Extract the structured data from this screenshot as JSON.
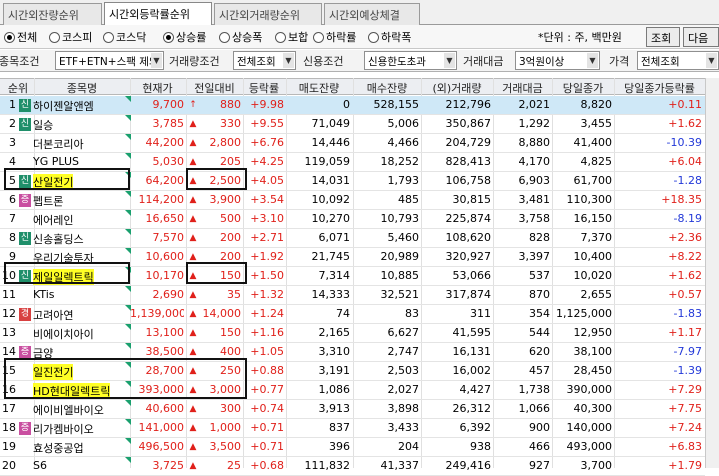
{
  "tabs": [
    "시간외잔량순위",
    "시간외등락률순위",
    "시간외거래량순위",
    "시간외예상체결"
  ],
  "active_tab": 1,
  "market_radios": [
    "전체",
    "코스피",
    "코스닥"
  ],
  "rank_radios": [
    "상승률",
    "상승폭",
    "보합",
    "하락률",
    "하락폭"
  ],
  "unit_text": "*단위 : 주, 백만원",
  "query_button": "조회",
  "next_button": "다음",
  "filters": {
    "item_cond_label": "종목조건",
    "item_cond_value": "ETF+ETN+스팩 제외",
    "trade_cond_label": "거래량조건",
    "trade_cond_value": "전체조회",
    "credit_cond_label": "신용조건",
    "credit_cond_value": "신용한도초과",
    "amount_label": "거래대금",
    "amount_value": "3억원이상",
    "price_label": "가격",
    "price_value": "전체조회"
  },
  "columns": [
    "순위",
    "종목명",
    "현재가",
    "전일대비",
    "등락률",
    "매도잔량",
    "매수잔량",
    "(외)거래량",
    "거래대금",
    "당일종가",
    "당일종가등락률"
  ],
  "colors": {
    "up": "#e0201a",
    "down": "#2238d8",
    "highlight": "#ffff26",
    "badge_sin": "#1f8f6a",
    "badge_jeung": "#c94fa0",
    "badge_gyeong": "#d84040"
  },
  "rows": [
    {
      "rank": "1",
      "badge": "신",
      "name": "하이젠알앤엠",
      "price": "9,700",
      "dir": "limit",
      "change": "880",
      "rate": "+9.98",
      "sell": "0",
      "buy": "528,155",
      "volume": "212,796",
      "amount": "2,021",
      "close": "8,820",
      "close_rate": "+0.11",
      "close_up": true
    },
    {
      "rank": "2",
      "badge": "신",
      "name": "일승",
      "price": "3,785",
      "dir": "up",
      "change": "330",
      "rate": "+9.55",
      "sell": "71,049",
      "buy": "5,006",
      "volume": "350,867",
      "amount": "1,292",
      "close": "3,455",
      "close_rate": "+1.62",
      "close_up": true
    },
    {
      "rank": "3",
      "badge": "",
      "name": "더본코리아",
      "price": "44,200",
      "dir": "up",
      "change": "2,800",
      "rate": "+6.76",
      "sell": "14,446",
      "buy": "4,466",
      "volume": "204,729",
      "amount": "8,880",
      "close": "41,400",
      "close_rate": "-10.39",
      "close_up": false
    },
    {
      "rank": "4",
      "badge": "",
      "name": "YG PLUS",
      "price": "5,030",
      "dir": "up",
      "change": "205",
      "rate": "+4.25",
      "sell": "119,059",
      "buy": "18,252",
      "volume": "828,413",
      "amount": "4,170",
      "close": "4,825",
      "close_rate": "+6.04",
      "close_up": true
    },
    {
      "rank": "5",
      "badge": "신",
      "name": "산일전기",
      "price": "64,200",
      "dir": "up",
      "change": "2,500",
      "rate": "+4.05",
      "sell": "14,031",
      "buy": "1,793",
      "volume": "106,758",
      "amount": "6,903",
      "close": "61,700",
      "close_rate": "-1.28",
      "close_up": false
    },
    {
      "rank": "6",
      "badge": "증",
      "name": "펩트론",
      "price": "114,200",
      "dir": "up",
      "change": "3,900",
      "rate": "+3.54",
      "sell": "10,092",
      "buy": "485",
      "volume": "30,815",
      "amount": "3,481",
      "close": "110,300",
      "close_rate": "+18.35",
      "close_up": true
    },
    {
      "rank": "7",
      "badge": "",
      "name": "에어레인",
      "price": "16,650",
      "dir": "up",
      "change": "500",
      "rate": "+3.10",
      "sell": "10,270",
      "buy": "10,793",
      "volume": "225,874",
      "amount": "3,758",
      "close": "16,150",
      "close_rate": "-8.19",
      "close_up": false
    },
    {
      "rank": "8",
      "badge": "신",
      "name": "신송홀딩스",
      "price": "7,570",
      "dir": "up",
      "change": "200",
      "rate": "+2.71",
      "sell": "6,071",
      "buy": "5,460",
      "volume": "108,620",
      "amount": "828",
      "close": "7,370",
      "close_rate": "+2.36",
      "close_up": true
    },
    {
      "rank": "9",
      "badge": "",
      "name": "우리기술투자",
      "price": "10,600",
      "dir": "up",
      "change": "200",
      "rate": "+1.92",
      "sell": "21,745",
      "buy": "20,989",
      "volume": "320,927",
      "amount": "3,397",
      "close": "10,400",
      "close_rate": "+8.22",
      "close_up": true
    },
    {
      "rank": "10",
      "badge": "신",
      "name": "제일일렉트릭",
      "price": "10,170",
      "dir": "up",
      "change": "150",
      "rate": "+1.50",
      "sell": "7,314",
      "buy": "10,885",
      "volume": "53,066",
      "amount": "537",
      "close": "10,020",
      "close_rate": "+1.62",
      "close_up": true
    },
    {
      "rank": "11",
      "badge": "",
      "name": "KTis",
      "price": "2,690",
      "dir": "up",
      "change": "35",
      "rate": "+1.32",
      "sell": "14,333",
      "buy": "32,521",
      "volume": "317,874",
      "amount": "870",
      "close": "2,655",
      "close_rate": "+0.57",
      "close_up": true
    },
    {
      "rank": "12",
      "badge": "경",
      "name": "고려아연",
      "price": "1,139,000",
      "dir": "up",
      "change": "14,000",
      "rate": "+1.24",
      "sell": "74",
      "buy": "83",
      "volume": "311",
      "amount": "354",
      "close": "1,125,000",
      "close_rate": "-1.83",
      "close_up": false
    },
    {
      "rank": "13",
      "badge": "",
      "name": "비에이치아이",
      "price": "13,100",
      "dir": "up",
      "change": "150",
      "rate": "+1.16",
      "sell": "2,165",
      "buy": "6,627",
      "volume": "41,595",
      "amount": "544",
      "close": "12,950",
      "close_rate": "+1.17",
      "close_up": true
    },
    {
      "rank": "14",
      "badge": "증",
      "name": "금양",
      "price": "38,500",
      "dir": "up",
      "change": "400",
      "rate": "+1.05",
      "sell": "3,310",
      "buy": "2,747",
      "volume": "16,131",
      "amount": "620",
      "close": "38,100",
      "close_rate": "-7.97",
      "close_up": false
    },
    {
      "rank": "15",
      "badge": "",
      "name": "일진전기",
      "price": "28,700",
      "dir": "up",
      "change": "250",
      "rate": "+0.88",
      "sell": "3,191",
      "buy": "2,503",
      "volume": "16,002",
      "amount": "457",
      "close": "28,450",
      "close_rate": "-1.39",
      "close_up": false
    },
    {
      "rank": "16",
      "badge": "",
      "name": "HD현대일렉트릭",
      "price": "393,000",
      "dir": "up",
      "change": "3,000",
      "rate": "+0.77",
      "sell": "1,086",
      "buy": "2,027",
      "volume": "4,427",
      "amount": "1,738",
      "close": "390,000",
      "close_rate": "+7.29",
      "close_up": true
    },
    {
      "rank": "17",
      "badge": "",
      "name": "에이비엘바이오",
      "price": "40,600",
      "dir": "up",
      "change": "300",
      "rate": "+0.74",
      "sell": "3,913",
      "buy": "3,898",
      "volume": "26,312",
      "amount": "1,066",
      "close": "40,300",
      "close_rate": "+7.75",
      "close_up": true
    },
    {
      "rank": "18",
      "badge": "증",
      "name": "리가켐바이오",
      "price": "141,000",
      "dir": "up",
      "change": "1,000",
      "rate": "+0.71",
      "sell": "837",
      "buy": "3,433",
      "volume": "6,392",
      "amount": "900",
      "close": "140,000",
      "close_rate": "+7.24",
      "close_up": true
    },
    {
      "rank": "19",
      "badge": "",
      "name": "효성중공업",
      "price": "496,500",
      "dir": "up",
      "change": "3,500",
      "rate": "+0.71",
      "sell": "396",
      "buy": "204",
      "volume": "938",
      "amount": "466",
      "close": "493,000",
      "close_rate": "+6.83",
      "close_up": true
    },
    {
      "rank": "20",
      "badge": "",
      "name": "S6",
      "price": "3,725",
      "dir": "up",
      "change": "25",
      "rate": "+0.68",
      "sell": "111,832",
      "buy": "41,337",
      "volume": "249,416",
      "amount": "927",
      "close": "3,700",
      "close_rate": "+1.79",
      "close_up": true
    }
  ]
}
